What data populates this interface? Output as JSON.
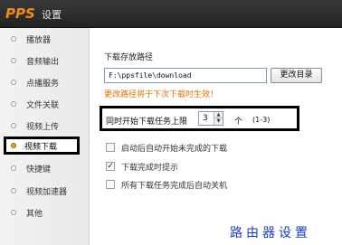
{
  "app": {
    "logo": "PPS",
    "title": "设置"
  },
  "sidebar": {
    "items": [
      {
        "label": "播放器"
      },
      {
        "label": "音频输出"
      },
      {
        "label": "点播服务"
      },
      {
        "label": "文件关联"
      },
      {
        "label": "视频上传"
      },
      {
        "label": "视频下载",
        "active": true
      },
      {
        "label": "快捷键"
      },
      {
        "label": "视频加速器"
      },
      {
        "label": "其他"
      }
    ]
  },
  "download": {
    "path_title": "下载存放路径",
    "path_value": "F:\\ppsfile\\download",
    "change_button": "更改目录",
    "path_warning": "更改路径将于下次下载时生效！",
    "limit_label": "同时开始下载任务上限",
    "limit_value": "3",
    "limit_unit": "个",
    "limit_range": "(1-3)",
    "options": [
      {
        "label": "启动后自动开始未完成的下载",
        "checked": false
      },
      {
        "label": "下载完成时提示",
        "checked": true
      },
      {
        "label": "所有下载任务完成后自动关机",
        "checked": false
      }
    ]
  },
  "watermark": "路由器设置",
  "colors": {
    "titlebar": "#2b2b2b",
    "logo": "#f08a1c",
    "warning": "#e07000",
    "watermark": "#1a3cc8"
  }
}
